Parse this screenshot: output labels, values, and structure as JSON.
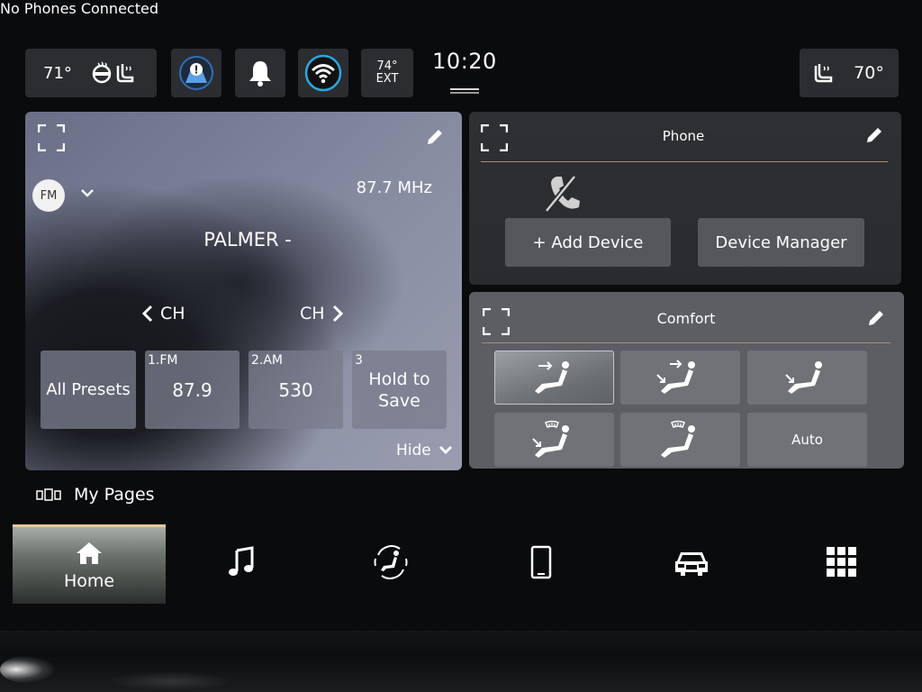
{
  "status_bar": {
    "driver_temp": "71°",
    "exterior_temp": "74°",
    "exterior_label": "EXT",
    "time": "10:20",
    "passenger_temp": "70°"
  },
  "radio": {
    "band": "FM",
    "frequency": "87.7 MHz",
    "station": "PALMER -",
    "ch_prev_label": "CH",
    "ch_next_label": "CH",
    "all_presets_label": "All Presets",
    "presets": [
      {
        "num": "1.FM",
        "value": "87.9"
      },
      {
        "num": "2.AM",
        "value": "530"
      },
      {
        "num": "3",
        "value": "Hold to Save"
      }
    ],
    "hide_label": "Hide"
  },
  "phone": {
    "title": "Phone",
    "status": "No Phones Connected",
    "add_device_label": "+ Add Device",
    "device_manager_label": "Device Manager"
  },
  "comfort": {
    "title": "Comfort",
    "auto_label": "Auto"
  },
  "my_pages": {
    "label": "My Pages"
  },
  "nav": {
    "home_label": "Home"
  },
  "colors": {
    "accent_divider": "#b08a72",
    "nav_active_border": "#e8c89a",
    "wifi_ring": "#29a8e0"
  }
}
